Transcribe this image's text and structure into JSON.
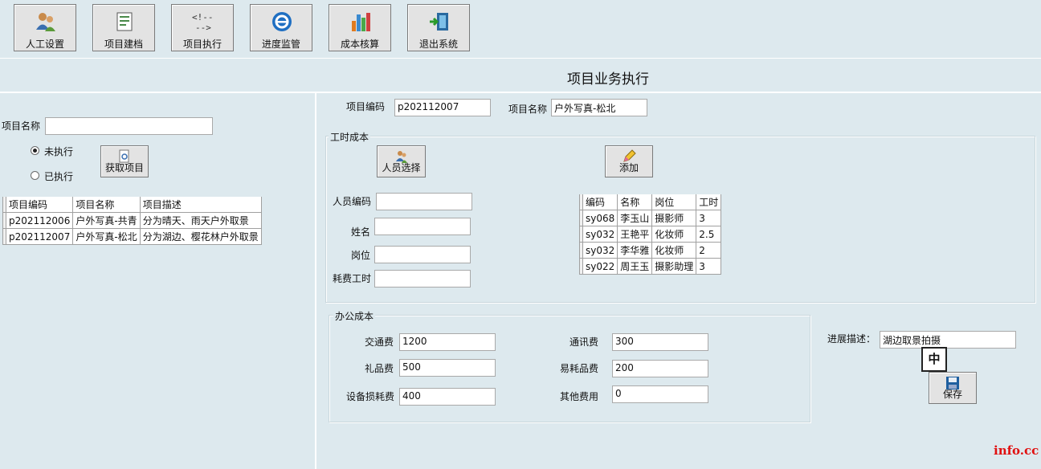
{
  "toolbar": {
    "items": [
      {
        "label": "人工设置",
        "icon": "users-icon"
      },
      {
        "label": "项目建档",
        "icon": "document-icon"
      },
      {
        "label": "项目执行",
        "icon": "code-icon"
      },
      {
        "label": "进度监管",
        "icon": "browser-icon"
      },
      {
        "label": "成本核算",
        "icon": "bar-chart-icon"
      },
      {
        "label": "退出系统",
        "icon": "exit-door-icon"
      }
    ]
  },
  "page_title": "项目业务执行",
  "left": {
    "project_name_label": "项目名称",
    "project_name_value": "",
    "radio_unexecuted": "未执行",
    "radio_executed": "已执行",
    "selected": "未执行",
    "fetch_button": "获取项目",
    "table": {
      "headers": [
        "项目编码",
        "项目名称",
        "项目描述"
      ],
      "rows": [
        [
          "p202112006",
          "户外写真-共青",
          "分为晴天、雨天户外取景"
        ],
        [
          "p202112007",
          "户外写真-松北",
          "分为湖边、樱花林户外取景"
        ]
      ]
    }
  },
  "right": {
    "code_label": "项目编码",
    "code_value": "p202112007",
    "name_label": "项目名称",
    "name_value": "户外写真-松北",
    "labor_group": {
      "title": "工时成本",
      "select_button": "人员选择",
      "add_button": "添加",
      "fields": {
        "staff_code_label": "人员编码",
        "name_label": "姓名",
        "position_label": "岗位",
        "hours_label": "耗费工时"
      },
      "table": {
        "headers": [
          "编码",
          "名称",
          "岗位",
          "工时"
        ],
        "rows": [
          [
            "sy068",
            "李玉山",
            "摄影师",
            "3"
          ],
          [
            "sy032",
            "王艳平",
            "化妆师",
            "2.5"
          ],
          [
            "sy032",
            "李华雅",
            "化妆师",
            "2"
          ],
          [
            "sy022",
            "周王玉",
            "摄影助理",
            "3"
          ]
        ]
      }
    },
    "office_group": {
      "title": "办公成本",
      "transport_label": "交通费",
      "transport_value": "1200",
      "gift_label": "礼品费",
      "gift_value": "500",
      "equipment_label": "设备损耗费",
      "equipment_value": "400",
      "comm_label": "通讯费",
      "comm_value": "300",
      "consumable_label": "易耗品费",
      "consumable_value": "200",
      "other_label": "其他费用",
      "other_value": "0"
    },
    "progress_label": "进展描述：",
    "progress_value": "湖边取景拍摄",
    "ime_indicator": "中",
    "save_button": "保存"
  },
  "watermark": "info.cc",
  "colors": {
    "background": "#dde9ee",
    "watermark": "#e01010"
  }
}
